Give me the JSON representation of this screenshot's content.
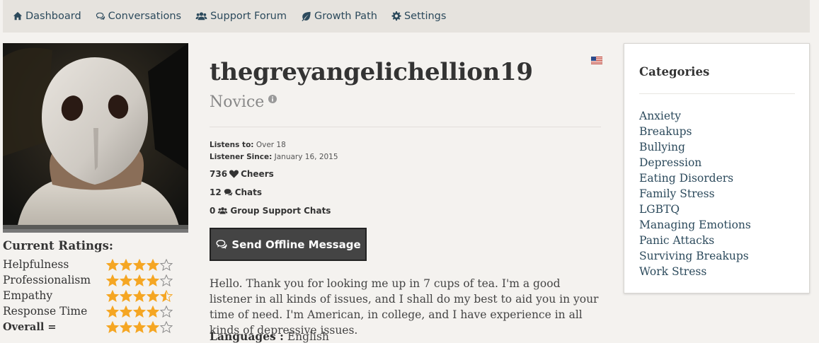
{
  "nav": {
    "items": [
      {
        "label": "Dashboard",
        "icon": "home-icon"
      },
      {
        "label": "Conversations",
        "icon": "chat-icon"
      },
      {
        "label": "Support Forum",
        "icon": "users-icon"
      },
      {
        "label": "Growth Path",
        "icon": "leaf-icon"
      },
      {
        "label": "Settings",
        "icon": "gear-icon"
      }
    ]
  },
  "profile": {
    "username": "thegreyangelichellion19",
    "rank": "Novice",
    "listens_to_label": "Listens to:",
    "listens_to_value": "Over 18",
    "listener_since_label": "Listener Since:",
    "listener_since_value": "January 16, 2015",
    "cheers_count": "736",
    "cheers_label": "Cheers",
    "chats_count": "12",
    "chats_label": "Chats",
    "group_count": "0",
    "group_label": "Group Support Chats",
    "send_button_label": "Send Offline Message",
    "bio": "Hello. Thank you for looking me up in 7 cups of tea. I'm a good listener in all kinds of issues, and I shall do my best to aid you in your time of need. I'm American, in college, and I have experience in all kinds of depressive issues.",
    "languages_label": "Languages :",
    "languages_value": "English",
    "flag_icon": "us-flag-icon"
  },
  "ratings": {
    "title": "Current Ratings:",
    "items": [
      {
        "label": "Helpfulness",
        "stars": 4,
        "bold": false
      },
      {
        "label": "Professionalism",
        "stars": 4,
        "bold": false
      },
      {
        "label": "Empathy",
        "stars": 4.5,
        "bold": false
      },
      {
        "label": "Response Time",
        "stars": 4,
        "bold": false
      },
      {
        "label": "Overall =",
        "stars": 4,
        "bold": true
      }
    ],
    "max_stars": 5
  },
  "categories": {
    "title": "Categories",
    "items": [
      "Anxiety",
      "Breakups",
      "Bullying",
      "Depression",
      "Eating Disorders",
      "Family Stress",
      "LGBTQ",
      "Managing Emotions",
      "Panic Attacks",
      "Surviving Breakups",
      "Work Stress"
    ]
  },
  "colors": {
    "nav_bg": "#e6e3de",
    "page_bg": "#f4f2ef",
    "link": "#2c4a5c",
    "star": "#f5a623",
    "button_bg": "#444444"
  }
}
